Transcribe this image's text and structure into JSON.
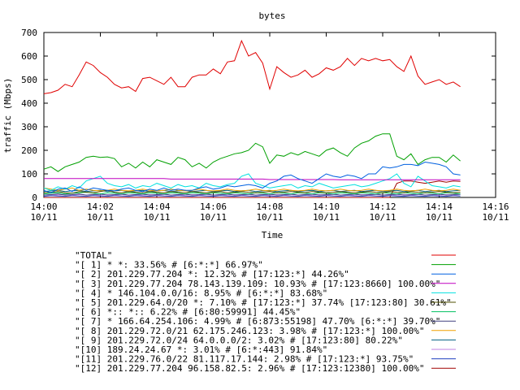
{
  "chart_data": {
    "type": "line",
    "title": "bytes",
    "xlabel": "Time",
    "ylabel": "traffic (Mbps)",
    "ylim": [
      0,
      700
    ],
    "xlim_minutes": [
      0,
      16
    ],
    "y_ticks": [
      "0",
      "100",
      "200",
      "300",
      "400",
      "500",
      "600",
      "700"
    ],
    "x_ticks": [
      {
        "time": "14:00",
        "date": "10/11"
      },
      {
        "time": "14:02",
        "date": "10/11"
      },
      {
        "time": "14:04",
        "date": "10/11"
      },
      {
        "time": "14:06",
        "date": "10/11"
      },
      {
        "time": "14:08",
        "date": "10/11"
      },
      {
        "time": "14:10",
        "date": "10/11"
      },
      {
        "time": "14:12",
        "date": "10/11"
      },
      {
        "time": "14:14",
        "date": "10/11"
      },
      {
        "time": "14:16",
        "date": "10/11"
      }
    ],
    "grid": false,
    "legend_position": "bottom",
    "x": [
      0,
      0.25,
      0.5,
      0.75,
      1,
      1.25,
      1.5,
      1.75,
      2,
      2.25,
      2.5,
      2.75,
      3,
      3.25,
      3.5,
      3.75,
      4,
      4.25,
      4.5,
      4.75,
      5,
      5.25,
      5.5,
      5.75,
      6,
      6.25,
      6.5,
      6.75,
      7,
      7.25,
      7.5,
      7.75,
      8,
      8.25,
      8.5,
      8.75,
      9,
      9.25,
      9.5,
      9.75,
      10,
      10.25,
      10.5,
      10.75,
      11,
      11.25,
      11.5,
      11.75,
      12,
      12.25,
      12.5,
      12.75,
      13,
      13.25,
      13.5,
      13.75,
      14,
      14.25,
      14.5,
      14.75
    ],
    "series": [
      {
        "name": "\"TOTAL\"",
        "color": "#e00000",
        "values": [
          440,
          445,
          455,
          480,
          470,
          520,
          575,
          560,
          530,
          510,
          480,
          465,
          470,
          450,
          505,
          510,
          495,
          480,
          510,
          470,
          470,
          510,
          520,
          520,
          545,
          525,
          575,
          580,
          665,
          600,
          615,
          570,
          460,
          555,
          530,
          510,
          520,
          540,
          510,
          525,
          550,
          540,
          555,
          590,
          560,
          590,
          580,
          590,
          580,
          585,
          555,
          535,
          600,
          515,
          480,
          490,
          500,
          480,
          490,
          470
        ]
      },
      {
        "name": "\"[ 1] * *: 33.56% # [6:*:*] 66.97%\"",
        "color": "#00a000",
        "values": [
          120,
          130,
          110,
          130,
          140,
          150,
          170,
          175,
          170,
          172,
          165,
          130,
          145,
          125,
          150,
          130,
          160,
          150,
          140,
          170,
          160,
          130,
          145,
          125,
          150,
          165,
          175,
          185,
          190,
          200,
          230,
          215,
          145,
          180,
          175,
          190,
          180,
          195,
          185,
          175,
          200,
          210,
          190,
          175,
          210,
          230,
          240,
          260,
          270,
          270,
          175,
          160,
          185,
          140,
          160,
          170,
          170,
          150,
          180,
          155
        ]
      },
      {
        "name": "\"[ 2] 201.229.77.204 *: 12.32% # [17:123:*] 44.26%\"",
        "color": "#0060e0",
        "values": [
          30,
          20,
          35,
          40,
          25,
          45,
          30,
          40,
          35,
          30,
          28,
          35,
          40,
          30,
          25,
          35,
          30,
          40,
          30,
          35,
          30,
          30,
          40,
          45,
          35,
          40,
          50,
          45,
          50,
          55,
          50,
          40,
          60,
          70,
          90,
          95,
          80,
          70,
          60,
          80,
          100,
          90,
          85,
          95,
          90,
          80,
          100,
          100,
          130,
          125,
          130,
          140,
          140,
          135,
          150,
          145,
          140,
          130,
          100,
          95
        ]
      },
      {
        "name": "\"[ 3] 201.229.77.204 78.143.139.109: 10.93% # [17:123:8660] 100.00%\"",
        "color": "#c000c0",
        "values": [
          80,
          80,
          80,
          80,
          80,
          80,
          80,
          80,
          80,
          80,
          80,
          80,
          80,
          80,
          80,
          80,
          80,
          80,
          78,
          78,
          78,
          78,
          78,
          78,
          78,
          78,
          78,
          78,
          78,
          78,
          78,
          78,
          76,
          76,
          76,
          76,
          76,
          76,
          76,
          76,
          76,
          76,
          75,
          75,
          75,
          75,
          75,
          75,
          75,
          75,
          75,
          75,
          75,
          75,
          75,
          75,
          75,
          75,
          75,
          75
        ]
      },
      {
        "name": "\"[ 4] * 146.104.0.0/16: 8.95% # [6:*:*] 83.68%\"",
        "color": "#00e0e0",
        "values": [
          40,
          30,
          45,
          35,
          50,
          40,
          70,
          80,
          90,
          60,
          50,
          45,
          55,
          40,
          50,
          45,
          60,
          50,
          40,
          55,
          45,
          50,
          40,
          60,
          50,
          45,
          55,
          60,
          90,
          100,
          60,
          50,
          40,
          45,
          50,
          55,
          40,
          50,
          45,
          60,
          50,
          40,
          45,
          50,
          55,
          45,
          50,
          60,
          70,
          80,
          100,
          60,
          45,
          90,
          70,
          50,
          45,
          40,
          50,
          45
        ]
      },
      {
        "name": "\"[ 5] 201.229.64.0/20 *: 7.10% # [17:123:*] 37.74% [17:123:80] 30.61%\"",
        "color": "#505000",
        "values": [
          20,
          22,
          25,
          20,
          18,
          25,
          22,
          20,
          25,
          30,
          22,
          20,
          25,
          22,
          20,
          25,
          22,
          20,
          25,
          22,
          20,
          25,
          22,
          20,
          22,
          25,
          20,
          22,
          25,
          22,
          20,
          22,
          25,
          20,
          22,
          25,
          22,
          20,
          25,
          22,
          20,
          22,
          25,
          22,
          20,
          22,
          25,
          22,
          20,
          25,
          22,
          20,
          25,
          22,
          20,
          22,
          25,
          22,
          20,
          22
        ]
      },
      {
        "name": "\"[ 6] *:: *:: 6.22% # [6:80:59991] 44.45%\"",
        "color": "#00c060",
        "values": [
          15,
          18,
          20,
          15,
          18,
          20,
          22,
          18,
          15,
          20,
          18,
          15,
          20,
          18,
          15,
          20,
          18,
          15,
          20,
          18,
          15,
          20,
          18,
          15,
          20,
          18,
          15,
          20,
          18,
          15,
          20,
          18,
          15,
          20,
          18,
          15,
          20,
          18,
          15,
          20,
          18,
          15,
          20,
          18,
          15,
          20,
          18,
          15,
          20,
          18,
          15,
          20,
          18,
          15,
          20,
          18,
          15,
          20,
          18,
          15
        ]
      },
      {
        "name": "\"[ 7] * 166.64.254.106: 4.99% # [6:873:55198] 47.70% [6:*:*] 39.70%\"",
        "color": "#404080",
        "values": [
          10,
          12,
          15,
          10,
          12,
          15,
          10,
          12,
          15,
          10,
          12,
          15,
          10,
          12,
          15,
          10,
          12,
          15,
          10,
          12,
          15,
          10,
          12,
          15,
          10,
          12,
          15,
          10,
          12,
          15,
          10,
          12,
          15,
          10,
          12,
          15,
          10,
          12,
          15,
          10,
          12,
          15,
          10,
          12,
          15,
          10,
          12,
          15,
          10,
          12,
          15,
          10,
          12,
          15,
          10,
          12,
          15,
          10,
          12,
          15
        ]
      },
      {
        "name": "\"[ 8] 201.229.72.0/21 62.175.246.123: 3.98% # [17:123:*] 100.00%\"",
        "color": "#f0a000",
        "values": [
          40,
          35,
          30,
          35,
          40,
          30,
          35,
          30,
          28,
          30,
          35,
          30,
          28,
          30,
          35,
          30,
          28,
          30,
          35,
          30,
          28,
          30,
          35,
          30,
          28,
          30,
          35,
          30,
          28,
          30,
          35,
          30,
          28,
          30,
          35,
          30,
          28,
          30,
          35,
          30,
          28,
          30,
          35,
          30,
          28,
          30,
          35,
          30,
          28,
          30,
          35,
          30,
          28,
          30,
          35,
          30,
          28,
          30,
          35,
          30
        ]
      },
      {
        "name": "\"[ 9] 201.229.72.0/24 64.0.0.0/2: 3.02% # [17:123:80] 80.22%\"",
        "color": "#006080",
        "values": [
          25,
          28,
          30,
          25,
          28,
          30,
          25,
          28,
          30,
          25,
          28,
          30,
          25,
          28,
          30,
          25,
          28,
          30,
          25,
          28,
          30,
          25,
          28,
          30,
          25,
          28,
          30,
          25,
          28,
          30,
          25,
          28,
          30,
          25,
          28,
          30,
          25,
          28,
          30,
          25,
          28,
          30,
          25,
          28,
          30,
          25,
          28,
          30,
          25,
          28,
          30,
          25,
          28,
          30,
          25,
          28,
          30,
          25,
          28,
          30
        ]
      },
      {
        "name": "\"[10] 189.24.24.67 *: 3.01% # [6:*:443] 91.84%\"",
        "color": "#c080e0",
        "values": [
          10,
          12,
          10,
          12,
          10,
          12,
          10,
          12,
          10,
          12,
          10,
          12,
          10,
          12,
          10,
          12,
          10,
          12,
          10,
          12,
          10,
          12,
          10,
          12,
          10,
          12,
          10,
          12,
          10,
          12,
          10,
          12,
          10,
          12,
          10,
          12,
          10,
          12,
          10,
          12,
          10,
          12,
          10,
          12,
          10,
          12,
          10,
          12,
          10,
          12,
          10,
          12,
          10,
          12,
          10,
          12,
          10,
          12,
          10,
          12
        ]
      },
      {
        "name": "\"[11] 201.229.76.0/22 81.117.17.144: 2.98% # [17:123:*] 93.75%\"",
        "color": "#2040c0",
        "values": [
          5,
          8,
          6,
          5,
          8,
          6,
          5,
          8,
          6,
          5,
          8,
          6,
          5,
          8,
          6,
          5,
          8,
          6,
          5,
          8,
          6,
          5,
          8,
          6,
          5,
          8,
          6,
          5,
          8,
          6,
          5,
          8,
          6,
          5,
          8,
          6,
          5,
          8,
          6,
          5,
          8,
          6,
          5,
          8,
          6,
          5,
          8,
          6,
          5,
          8,
          6,
          5,
          8,
          6,
          5,
          8,
          6,
          5,
          8,
          6
        ]
      },
      {
        "name": "\"[12] 201.229.77.204 96.158.82.5: 2.96% # [17:123:12380] 100.00%\"",
        "color": "#a00000",
        "values": [
          0,
          0,
          0,
          0,
          0,
          0,
          0,
          0,
          0,
          0,
          0,
          0,
          0,
          0,
          0,
          0,
          0,
          0,
          0,
          0,
          0,
          0,
          0,
          0,
          0,
          0,
          0,
          0,
          0,
          0,
          0,
          0,
          0,
          0,
          0,
          0,
          0,
          0,
          0,
          0,
          0,
          0,
          0,
          0,
          0,
          0,
          0,
          0,
          0,
          0,
          60,
          70,
          70,
          65,
          60,
          65,
          70,
          65,
          70,
          68
        ]
      }
    ]
  }
}
